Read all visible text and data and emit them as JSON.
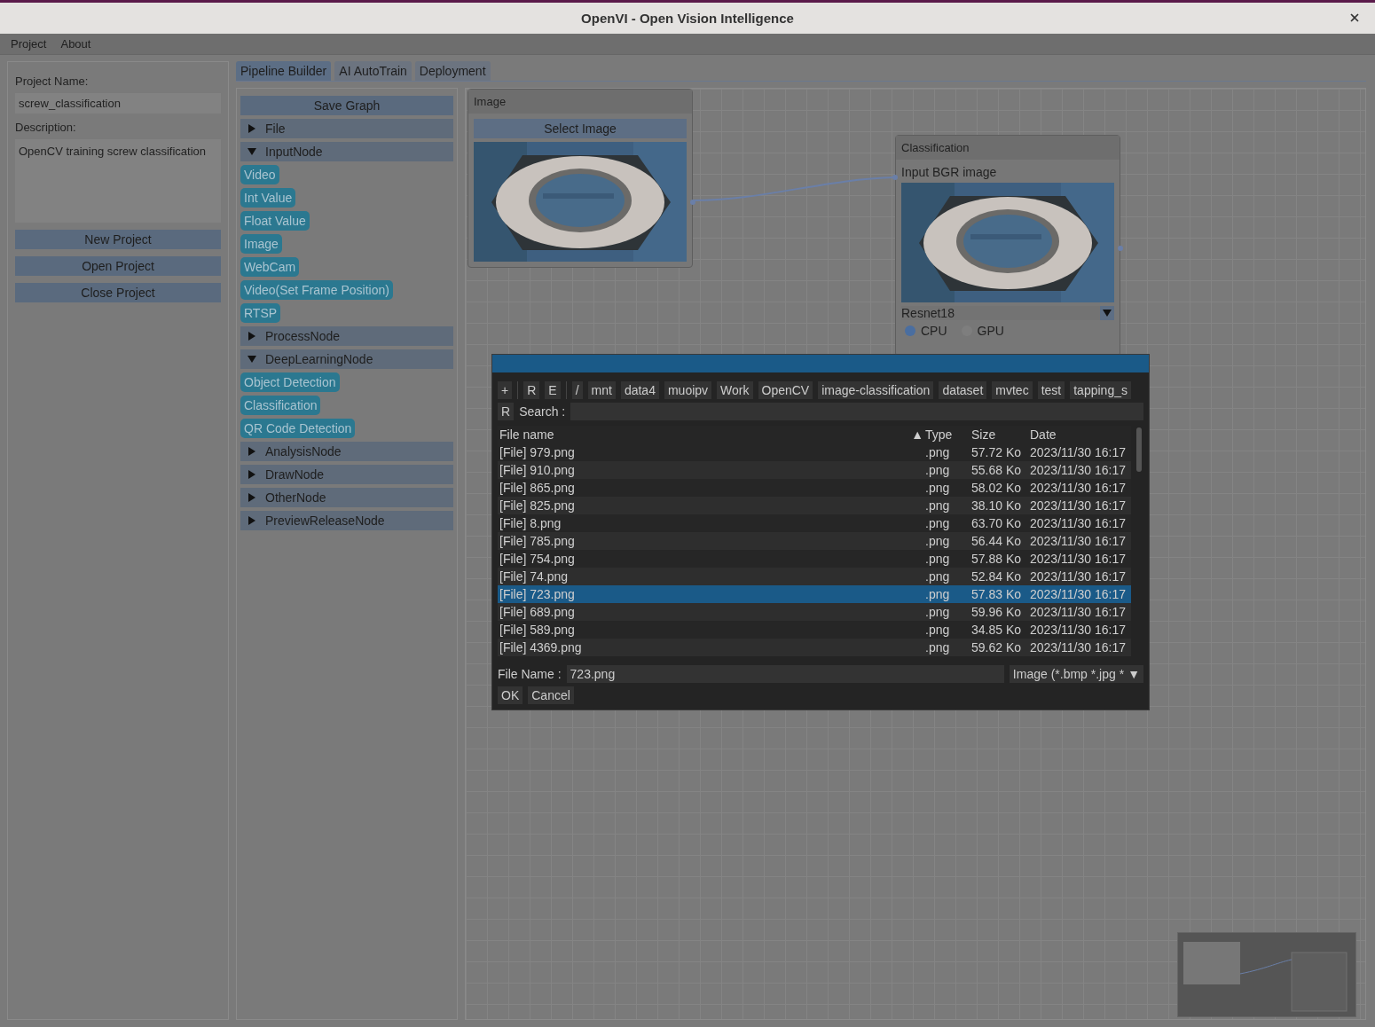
{
  "window": {
    "title": "OpenVI - Open Vision Intelligence"
  },
  "menu": [
    "Project",
    "About"
  ],
  "project": {
    "name_label": "Project Name:",
    "name_value": "screw_classification",
    "description_label": "Description:",
    "description_value": "OpenCV training screw classification",
    "buttons": [
      "New Project",
      "Open Project",
      "Close Project"
    ]
  },
  "tabs": [
    {
      "label": "Pipeline Builder",
      "selected": true
    },
    {
      "label": "AI AutoTrain",
      "selected": false
    },
    {
      "label": "Deployment",
      "selected": false
    }
  ],
  "palette": {
    "save_button": "Save Graph",
    "categories": [
      {
        "label": "File",
        "expanded": false
      },
      {
        "label": "InputNode",
        "expanded": true,
        "children": [
          "Video",
          "Int Value",
          "Float Value",
          "Image",
          "WebCam",
          "Video(Set Frame Position)",
          "RTSP"
        ]
      },
      {
        "label": "ProcessNode",
        "expanded": false
      },
      {
        "label": "DeepLearningNode",
        "expanded": true,
        "children": [
          "Object Detection",
          "Classification",
          "QR Code Detection"
        ]
      },
      {
        "label": "AnalysisNode",
        "expanded": false
      },
      {
        "label": "DrawNode",
        "expanded": false
      },
      {
        "label": "OtherNode",
        "expanded": false
      },
      {
        "label": "PreviewReleaseNode",
        "expanded": false
      }
    ]
  },
  "canvas": {
    "image_node": {
      "title": "Image",
      "button": "Select Image"
    },
    "classification_node": {
      "title": "Classification",
      "input_label": "Input BGR image",
      "model": "Resnet18",
      "devices": [
        {
          "label": "CPU",
          "selected": true
        },
        {
          "label": "GPU",
          "selected": false
        }
      ]
    }
  },
  "file_dialog": {
    "tools": [
      "+",
      "R",
      "E"
    ],
    "path": [
      "/",
      "mnt",
      "data4",
      "muoipv",
      "Work",
      "OpenCV",
      "image-classification",
      "dataset",
      "mvtec",
      "test",
      "tapping_s"
    ],
    "search_reset": "R",
    "search_label": "Search :",
    "columns": [
      "File name",
      "Type",
      "Size",
      "Date"
    ],
    "sort_indicator": "▲",
    "rows": [
      {
        "name": "[File] 979.png",
        "type": ".png",
        "size": "57.72 Ko",
        "date": "2023/11/30 16:17",
        "selected": false
      },
      {
        "name": "[File] 910.png",
        "type": ".png",
        "size": "55.68 Ko",
        "date": "2023/11/30 16:17",
        "selected": false
      },
      {
        "name": "[File] 865.png",
        "type": ".png",
        "size": "58.02 Ko",
        "date": "2023/11/30 16:17",
        "selected": false
      },
      {
        "name": "[File] 825.png",
        "type": ".png",
        "size": "38.10 Ko",
        "date": "2023/11/30 16:17",
        "selected": false
      },
      {
        "name": "[File] 8.png",
        "type": ".png",
        "size": "63.70 Ko",
        "date": "2023/11/30 16:17",
        "selected": false
      },
      {
        "name": "[File] 785.png",
        "type": ".png",
        "size": "56.44 Ko",
        "date": "2023/11/30 16:17",
        "selected": false
      },
      {
        "name": "[File] 754.png",
        "type": ".png",
        "size": "57.88 Ko",
        "date": "2023/11/30 16:17",
        "selected": false
      },
      {
        "name": "[File] 74.png",
        "type": ".png",
        "size": "52.84 Ko",
        "date": "2023/11/30 16:17",
        "selected": false
      },
      {
        "name": "[File] 723.png",
        "type": ".png",
        "size": "57.83 Ko",
        "date": "2023/11/30 16:17",
        "selected": true
      },
      {
        "name": "[File] 689.png",
        "type": ".png",
        "size": "59.96 Ko",
        "date": "2023/11/30 16:17",
        "selected": false
      },
      {
        "name": "[File] 589.png",
        "type": ".png",
        "size": "34.85 Ko",
        "date": "2023/11/30 16:17",
        "selected": false
      },
      {
        "name": "[File] 4369.png",
        "type": ".png",
        "size": "59.62 Ko",
        "date": "2023/11/30 16:17",
        "selected": false
      }
    ],
    "filename_label": "File Name :",
    "filename_value": "723.png",
    "filter": "Image (*.bmp *.jpg *",
    "filter_caret": "▼",
    "buttons": [
      "OK",
      "Cancel"
    ]
  }
}
